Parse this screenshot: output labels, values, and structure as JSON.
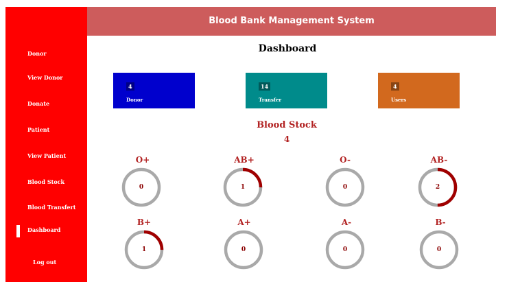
{
  "header": {
    "title": "Blood Bank Management System"
  },
  "sidebar": {
    "items": [
      {
        "label": "Donor"
      },
      {
        "label": "View Donor"
      },
      {
        "label": "Donate"
      },
      {
        "label": "Patient"
      },
      {
        "label": "View Patient"
      },
      {
        "label": "Blood Stock"
      },
      {
        "label": "Blood Transfert"
      },
      {
        "label": "Dashboard",
        "active": true
      },
      {
        "label": "Log out"
      }
    ]
  },
  "main": {
    "title": "Dashboard",
    "cards": [
      {
        "count": "4",
        "label": "Donor",
        "color": "#0000cd"
      },
      {
        "count": "14",
        "label": "Transfer",
        "color": "#008b8b"
      },
      {
        "count": "4",
        "label": "Users",
        "color": "#d2691e"
      }
    ],
    "stock": {
      "title": "Blood Stock",
      "total": "4",
      "groups": [
        {
          "type": "O+",
          "value": "0",
          "fraction": 0
        },
        {
          "type": "AB+",
          "value": "1",
          "fraction": 0.25
        },
        {
          "type": "O-",
          "value": "0",
          "fraction": 0
        },
        {
          "type": "AB-",
          "value": "2",
          "fraction": 0.5
        },
        {
          "type": "B+",
          "value": "1",
          "fraction": 0.25
        },
        {
          "type": "A+",
          "value": "0",
          "fraction": 0
        },
        {
          "type": "A-",
          "value": "0",
          "fraction": 0
        },
        {
          "type": "B-",
          "value": "0",
          "fraction": 0
        }
      ]
    }
  },
  "colors": {
    "sidebar": "#ff0000",
    "header": "#cd5c5c",
    "accent": "#b22222",
    "gauge_track": "#a9a9a9",
    "gauge_fill": "#a00000"
  }
}
